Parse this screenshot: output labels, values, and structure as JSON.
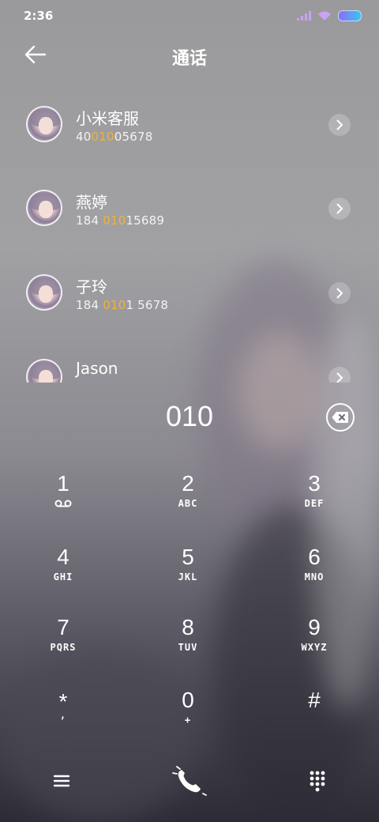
{
  "status_bar": {
    "time": "2:36"
  },
  "header": {
    "title": "通话"
  },
  "contacts": [
    {
      "name": "小米客服",
      "number_pre": "40",
      "number_match": "010",
      "number_post": "05678"
    },
    {
      "name": "燕婷",
      "number_pre": "184 ",
      "number_match": "010",
      "number_post": "15689"
    },
    {
      "name": "子玲",
      "number_pre": "184 ",
      "number_match": "010",
      "number_post": "1 5678"
    },
    {
      "name": "Jason",
      "number_pre": "",
      "number_match": "",
      "number_post": ""
    }
  ],
  "dialer": {
    "number": "010"
  },
  "keypad": [
    {
      "digit": "1",
      "letters": ""
    },
    {
      "digit": "2",
      "letters": "ABC"
    },
    {
      "digit": "3",
      "letters": "DEF"
    },
    {
      "digit": "4",
      "letters": "GHI"
    },
    {
      "digit": "5",
      "letters": "JKL"
    },
    {
      "digit": "6",
      "letters": "MNO"
    },
    {
      "digit": "7",
      "letters": "PQRS"
    },
    {
      "digit": "8",
      "letters": "TUV"
    },
    {
      "digit": "9",
      "letters": "WXYZ"
    },
    {
      "digit": "*",
      "letters": ","
    },
    {
      "digit": "0",
      "letters": "+"
    },
    {
      "digit": "#",
      "letters": ""
    }
  ],
  "colors": {
    "match_highlight": "#f1b13b",
    "battery_start": "#8d6cf6",
    "battery_end": "#39c6f2"
  },
  "icons": {
    "back": "arrow-left-icon",
    "backspace": "backspace-icon",
    "menu": "hamburger-icon",
    "call": "phone-icon",
    "dialpad": "dialpad-icon",
    "voicemail": "voicemail-icon"
  }
}
